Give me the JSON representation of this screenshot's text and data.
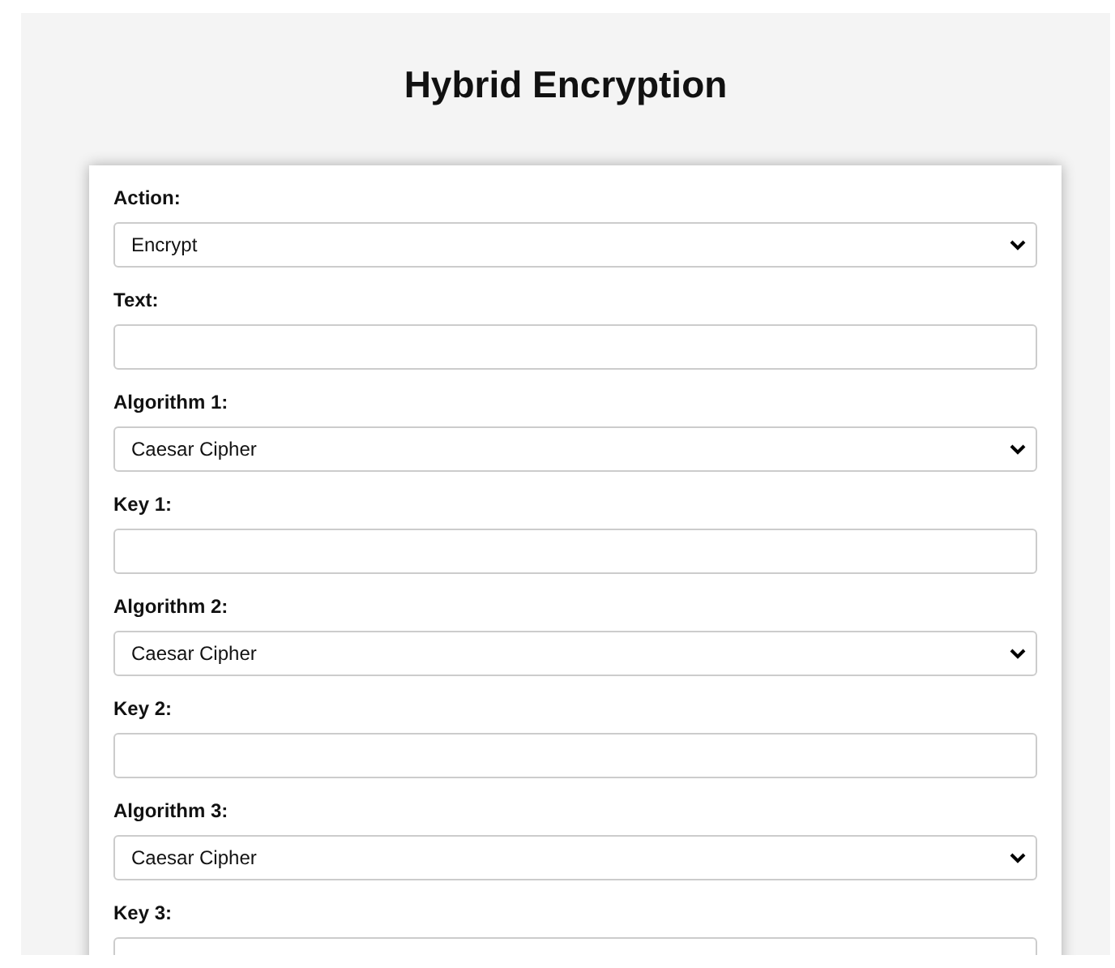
{
  "title": "Hybrid Encryption",
  "fields": [
    {
      "kind": "select",
      "label": "Action:",
      "value": "Encrypt"
    },
    {
      "kind": "text",
      "label": "Text:"
    },
    {
      "kind": "select",
      "label": "Algorithm 1:",
      "value": "Caesar Cipher"
    },
    {
      "kind": "text",
      "label": "Key 1:"
    },
    {
      "kind": "select",
      "label": "Algorithm 2:",
      "value": "Caesar Cipher"
    },
    {
      "kind": "text",
      "label": "Key 2:"
    },
    {
      "kind": "select",
      "label": "Algorithm 3:",
      "value": "Caesar Cipher"
    },
    {
      "kind": "text",
      "label": "Key 3:"
    }
  ]
}
